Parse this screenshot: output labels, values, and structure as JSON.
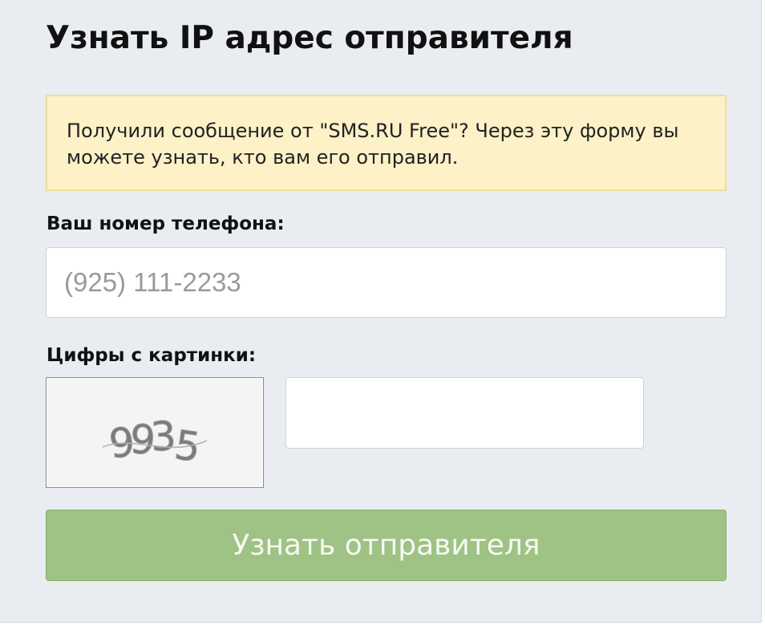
{
  "page": {
    "title": "Узнать IP адрес отправителя"
  },
  "notice": {
    "text": "Получили сообщение от \"SMS.RU Free\"? Через эту форму вы можете узнать, кто вам его отправил."
  },
  "phone": {
    "label": "Ваш номер телефона:",
    "placeholder": "(925) 111-2233",
    "value": ""
  },
  "captcha": {
    "label": "Цифры с картинки:",
    "image_digits": "9935",
    "value": ""
  },
  "submit": {
    "label": "Узнать отправителя"
  },
  "colors": {
    "background": "#e9ecf1",
    "notice_background": "#fcf1c7",
    "notice_border": "#f1df98",
    "button": "#9ec384"
  }
}
